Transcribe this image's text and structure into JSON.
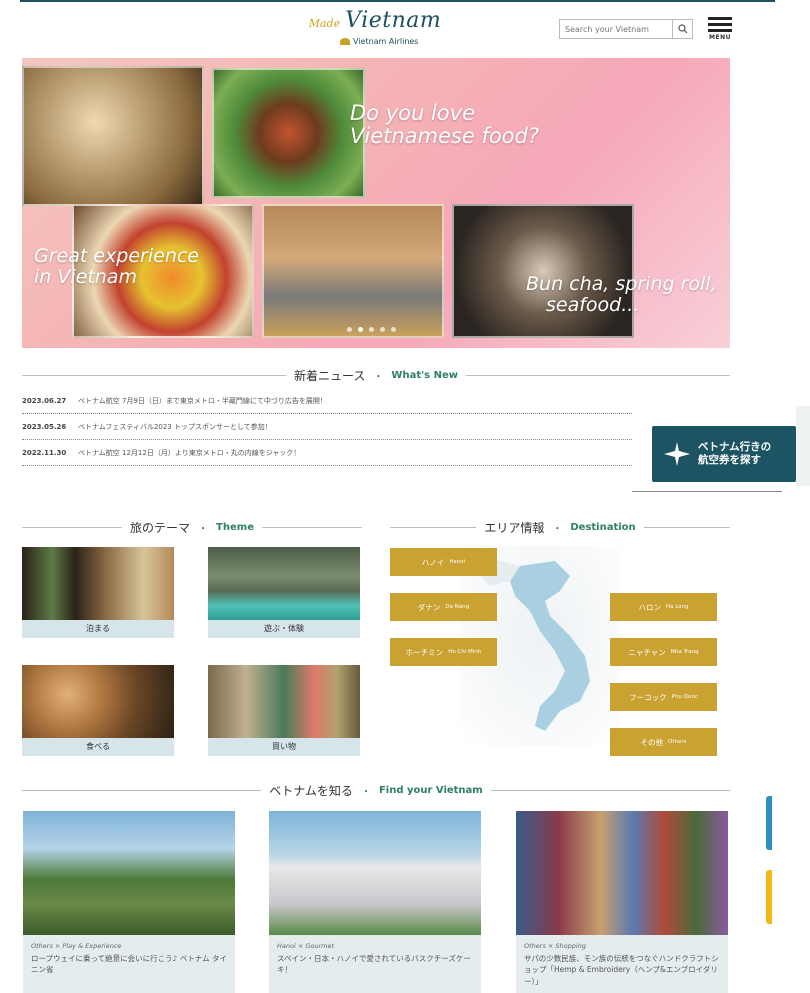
{
  "header": {
    "logo_script": "Made",
    "logo_main": "Vietnam",
    "logo_sub": "Vietnam Airlines",
    "search_placeholder": "Search your Vietnam",
    "menu_label": "MENU"
  },
  "hero": {
    "text1_line1": "Do you love",
    "text1_line2": "Vietnamese food?",
    "text2_line1": "Great experience",
    "text2_line2": "in Vietnam",
    "text3_line1": "Bun cha, spring roll,",
    "text3_line2": "seafood...",
    "slide_count": 5,
    "active_slide": 1
  },
  "news": {
    "heading_jp": "新着ニュース",
    "heading_sep": "・",
    "heading_en": "What's New",
    "items": [
      {
        "date": "2023.06.27",
        "text": "ベトナム航空 7月9日（日）まで東京メトロ・半蔵門線にて中づり広告を展開！"
      },
      {
        "date": "2023.05.26",
        "text": "ベトナムフェスティバル2023 トップスポンサーとして参加！"
      },
      {
        "date": "2022.11.30",
        "text": "ベトナム航空 12月12日（月）より東京メトロ・丸の内線をジャック！"
      }
    ]
  },
  "flight_button": {
    "line1": "ベトナム行きの",
    "line2": "航空券を探す"
  },
  "theme": {
    "heading_jp": "旅のテーマ",
    "heading_sep": "・",
    "heading_en": "Theme",
    "items": [
      {
        "label": "泊まる"
      },
      {
        "label": "遊ぶ・体験"
      },
      {
        "label": "食べる"
      },
      {
        "label": "買い物"
      }
    ]
  },
  "destination": {
    "heading_jp": "エリア情報",
    "heading_sep": "・",
    "heading_en": "Destination",
    "items": [
      {
        "jp": "ハノイ",
        "en": "Hanoi"
      },
      {
        "jp": "ダナン",
        "en": "Da Nang"
      },
      {
        "jp": "ホーチミン",
        "en": "Ho Chi Minh"
      },
      {
        "jp": "ハロン",
        "en": "Ha Long"
      },
      {
        "jp": "ニャチャン",
        "en": "Nha Trang"
      },
      {
        "jp": "フーコック",
        "en": "Phu Quoc"
      },
      {
        "jp": "その他",
        "en": "Others"
      }
    ]
  },
  "find": {
    "heading_jp": "ベトナムを知る",
    "heading_sep": "・",
    "heading_en": "Find your Vietnam",
    "articles": [
      {
        "category": "Others × Play & Experience",
        "title": "ロープウェイに乗って絶景に会いに行こう♪ ベトナム タイニン省"
      },
      {
        "category": "Hanoi × Gourmet",
        "title": "スペイン・日本・ハノイで愛されているバスクチーズケーキ！"
      },
      {
        "category": "Others × Shopping",
        "title": "サパの少数民族、モン族の伝統をつなぐハンドクラフトショップ「Hemp & Embroidery（ヘンプ&エンブロイダリー）」"
      }
    ]
  },
  "colors": {
    "brand_dark": "#1d4f5e",
    "gold": "#c9a232",
    "accent_green": "#2f8060"
  }
}
